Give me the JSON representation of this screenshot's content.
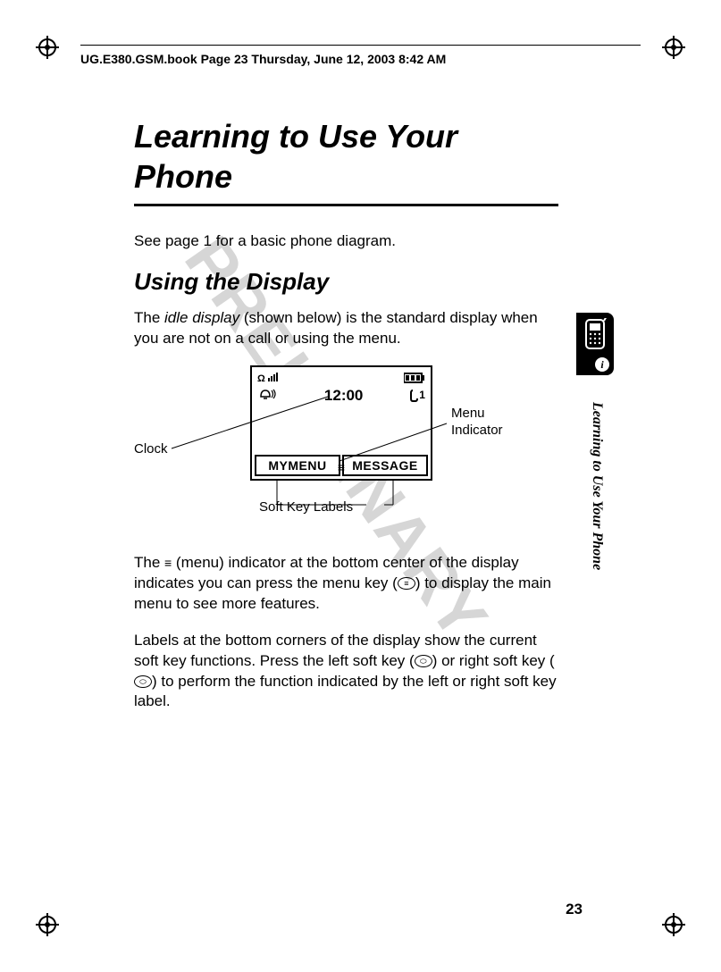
{
  "header": "UG.E380.GSM.book  Page 23  Thursday, June 12, 2003  8:42 AM",
  "watermark": "PRELIMINARY",
  "title": "Learning to Use Your Phone",
  "intro": "See page 1 for a basic phone diagram.",
  "subtitle": "Using the Display",
  "para1_a": "The ",
  "para1_i": "idle display",
  "para1_b": " (shown below) is the standard display when you are not on a call or using the menu.",
  "figure": {
    "clock": "12:00",
    "softkey_left": "MYMENU",
    "softkey_right": "MESSAGE",
    "line_indicator": "1",
    "callout_clock": "Clock",
    "callout_menu": "Menu Indicator",
    "callout_softkeys": "Soft Key Labels"
  },
  "para2_a": "The ",
  "para2_b": " (menu) indicator at the bottom center of the display indicates you can press the menu key (",
  "para2_c": ") to display the main menu to see more features.",
  "para3_a": "Labels at the bottom corners of the display show the current soft key functions. Press the left soft key (",
  "para3_b": ") or right soft key (",
  "para3_c": ") to perform the function indicated by the left or right soft key label.",
  "side_caption": "Learning to Use Your Phone",
  "page_number": "23"
}
